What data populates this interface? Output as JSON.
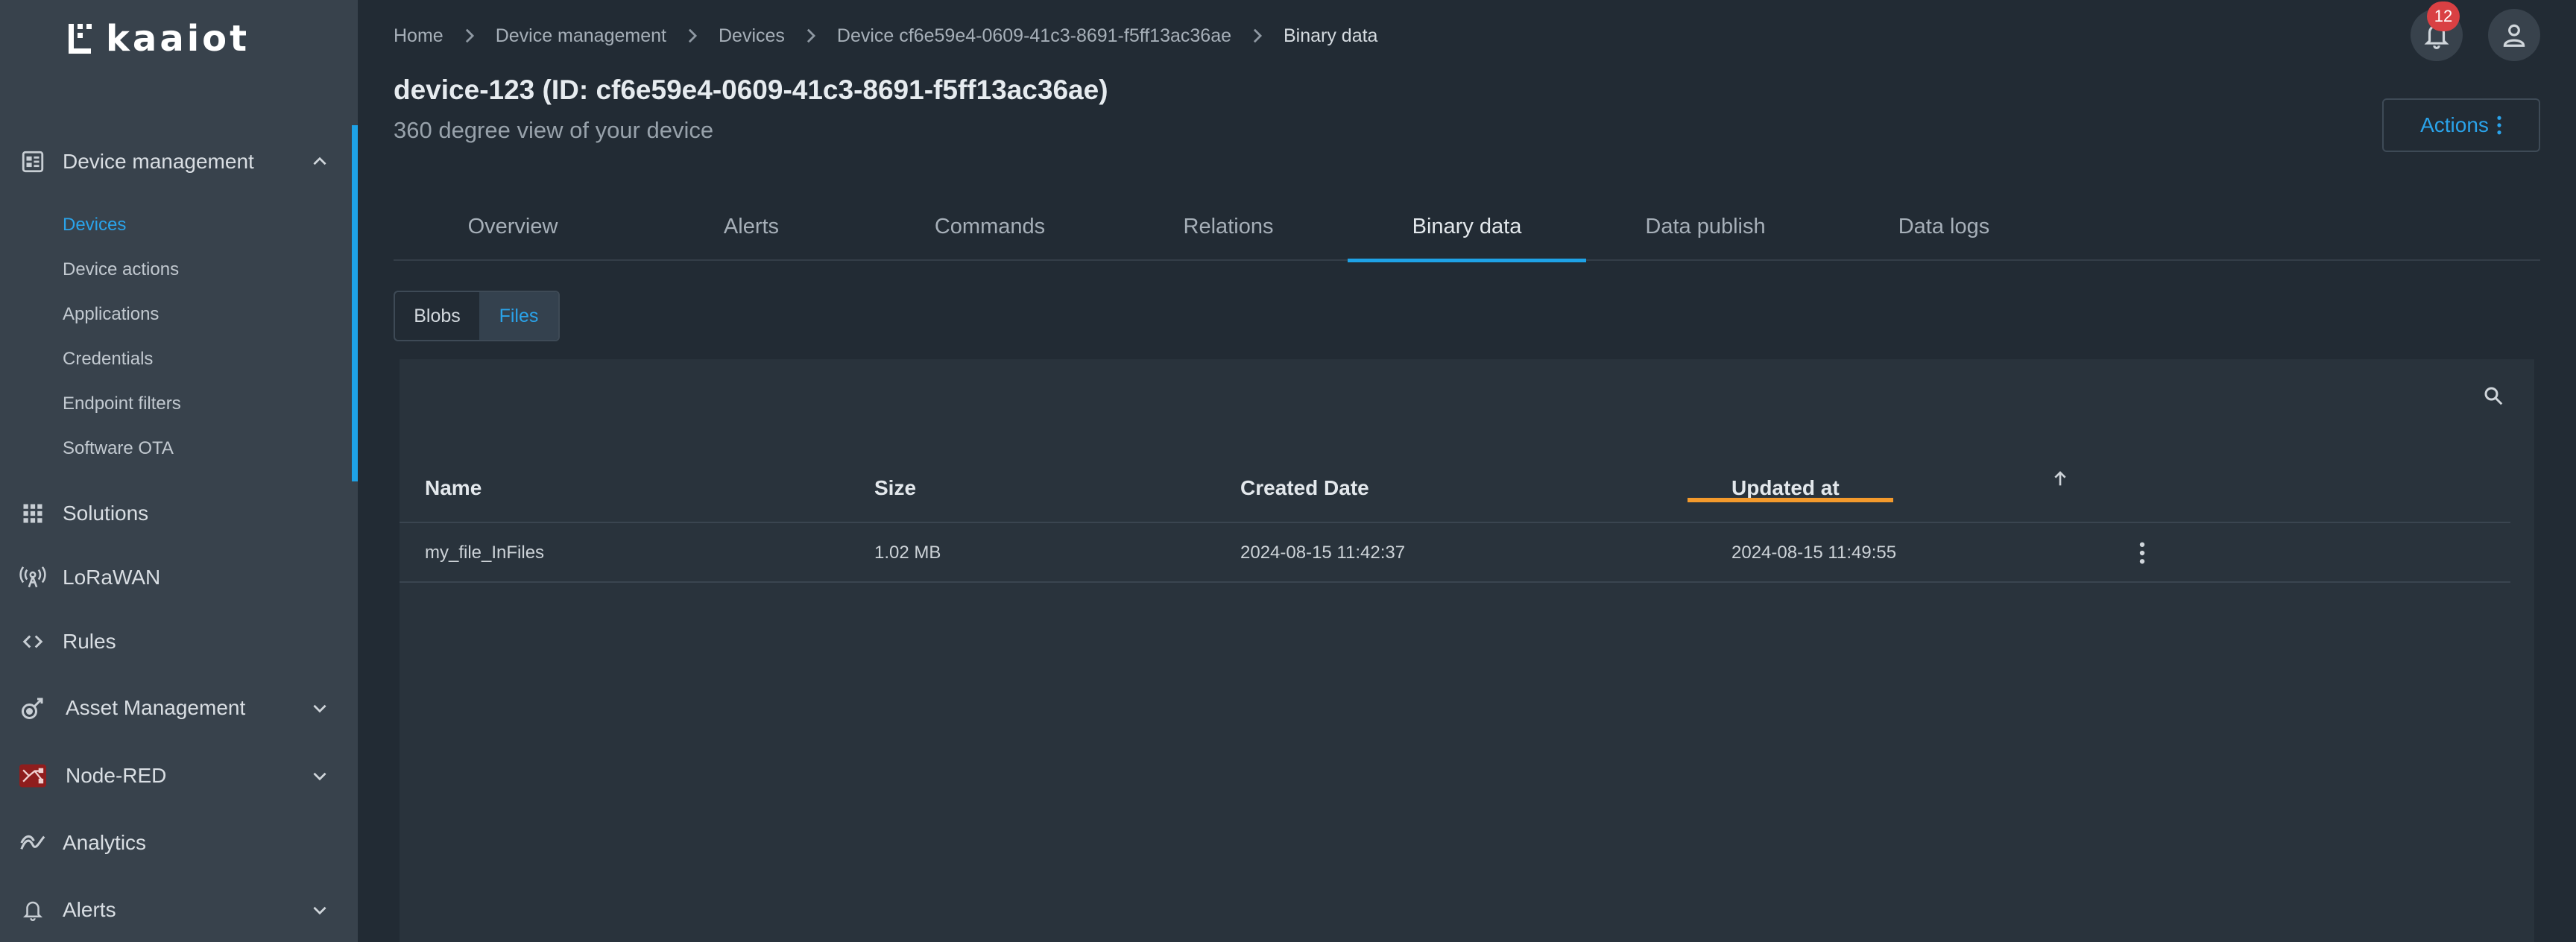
{
  "app": {
    "logo_text": "kaaiot"
  },
  "colors": {
    "accent": "#1ea2e6",
    "sort_indicator": "#f39a2c",
    "badge": "#d94043"
  },
  "sidebar": {
    "groups": [
      {
        "label": "Device management",
        "icon": "device-management-icon",
        "expanded": true
      },
      {
        "label": "Solutions",
        "icon": "grid-icon"
      },
      {
        "label": "LoRaWAN",
        "icon": "antenna-icon"
      },
      {
        "label": "Rules",
        "icon": "code-icon"
      },
      {
        "label": "Asset Management",
        "icon": "asset-icon",
        "expandable": true
      },
      {
        "label": "Node-RED",
        "icon": "node-red-icon",
        "expandable": true
      },
      {
        "label": "Analytics",
        "icon": "analytics-icon"
      },
      {
        "label": "Alerts",
        "icon": "bell-icon",
        "expandable": true
      }
    ],
    "sub_items": [
      {
        "label": "Devices",
        "active": true
      },
      {
        "label": "Device actions"
      },
      {
        "label": "Applications"
      },
      {
        "label": "Credentials"
      },
      {
        "label": "Endpoint filters"
      },
      {
        "label": "Software OTA"
      }
    ]
  },
  "breadcrumb": [
    "Home",
    "Device management",
    "Devices",
    "Device cf6e59e4-0609-41c3-8691-f5ff13ac36ae",
    "Binary data"
  ],
  "header": {
    "notifications_count": "12"
  },
  "page": {
    "title": "device-123 (ID: cf6e59e4-0609-41c3-8691-f5ff13ac36ae)",
    "subtitle": "360 degree view of your device",
    "actions_label": "Actions"
  },
  "tabs": [
    {
      "label": "Overview"
    },
    {
      "label": "Alerts"
    },
    {
      "label": "Commands"
    },
    {
      "label": "Relations"
    },
    {
      "label": "Binary data",
      "active": true
    },
    {
      "label": "Data publish"
    },
    {
      "label": "Data logs"
    }
  ],
  "toggle": {
    "options": [
      "Blobs",
      "Files"
    ],
    "selected": "Files"
  },
  "table": {
    "columns": [
      "Name",
      "Size",
      "Created Date",
      "Updated at"
    ],
    "sorted_column": "Updated at",
    "rows": [
      {
        "name": "my_file_InFiles",
        "size": "1.02 MB",
        "created": "2024-08-15 11:42:37",
        "updated": "2024-08-15 11:49:55"
      }
    ]
  }
}
